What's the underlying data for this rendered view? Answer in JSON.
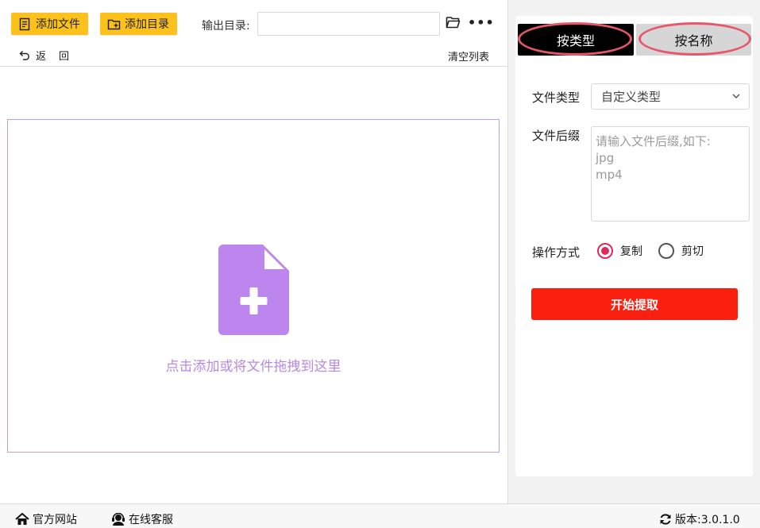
{
  "toolbar": {
    "add_file_label": "添加文件",
    "add_dir_label": "添加目录",
    "output_label": "输出目录:",
    "output_value": "",
    "back_label": "返",
    "back_label2": "回",
    "clear_label": "清空列表"
  },
  "drop_zone": {
    "text": "点击添加或将文件拖拽到这里"
  },
  "tabs": {
    "by_type": "按类型",
    "by_name": "按名称"
  },
  "form": {
    "file_type_label": "文件类型",
    "file_type_value": "自定义类型",
    "suffix_label": "文件后缀",
    "suffix_placeholder": "请输入文件后缀,如下:\njpg\nmp4",
    "operation_label": "操作方式",
    "copy_label": "复制",
    "cut_label": "剪切",
    "start_label": "开始提取"
  },
  "footer": {
    "site_label": "官方网站",
    "service_label": "在线客服",
    "version_label": "版本:3.0.1.0"
  },
  "colors": {
    "accent_yellow": "#fcc21b",
    "drop_purple": "#b889dd",
    "start_red": "#fb1f0f",
    "radio_pink": "#e0285a",
    "highlight_ring": "#e8566b"
  },
  "icons": [
    "add-file-icon",
    "add-folder-icon",
    "folder-open-icon",
    "more-icon",
    "undo-icon",
    "document-plus-icon",
    "chevron-down-icon",
    "home-icon",
    "headset-icon",
    "refresh-icon"
  ]
}
